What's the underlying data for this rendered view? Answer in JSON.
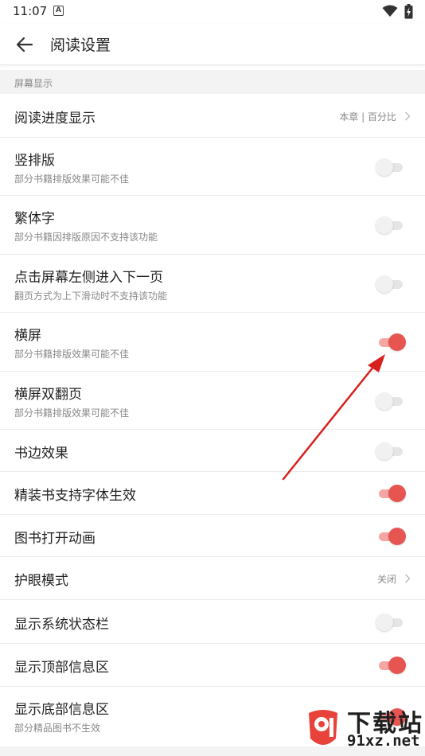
{
  "status_bar": {
    "time": "11:07",
    "notification_letter": "A"
  },
  "header": {
    "title": "阅读设置"
  },
  "section": {
    "title": "屏幕显示"
  },
  "settings": [
    {
      "title": "阅读进度显示",
      "value": "本章 | 百分比"
    },
    {
      "title": "竖排版",
      "subtitle": "部分书籍排版效果可能不佳",
      "enabled": false
    },
    {
      "title": "繁体字",
      "subtitle": "部分书籍因排版原因不支持该功能",
      "enabled": false
    },
    {
      "title": "点击屏幕左侧进入下一页",
      "subtitle": "翻页方式为上下滑动时不支持该功能",
      "enabled": false
    },
    {
      "title": "横屏",
      "subtitle": "部分书籍排版效果可能不佳",
      "enabled": true
    },
    {
      "title": "横屏双翻页",
      "subtitle": "部分书籍排版效果可能不佳",
      "enabled": false
    },
    {
      "title": "书边效果",
      "enabled": false
    },
    {
      "title": "精装书支持字体生效",
      "enabled": true
    },
    {
      "title": "图书打开动画",
      "enabled": true
    },
    {
      "title": "护眼模式",
      "value": "关闭"
    },
    {
      "title": "显示系统状态栏",
      "enabled": false
    },
    {
      "title": "显示顶部信息区",
      "enabled": true
    },
    {
      "title": "显示底部信息区",
      "subtitle": "部分精品图书不生效",
      "enabled": true
    }
  ],
  "watermark": {
    "line1": "下载站",
    "line2": "91xz.net"
  },
  "colors": {
    "accent": "#e65550",
    "accent_track": "#f3a6a3",
    "annotation_arrow": "#d8201c"
  }
}
